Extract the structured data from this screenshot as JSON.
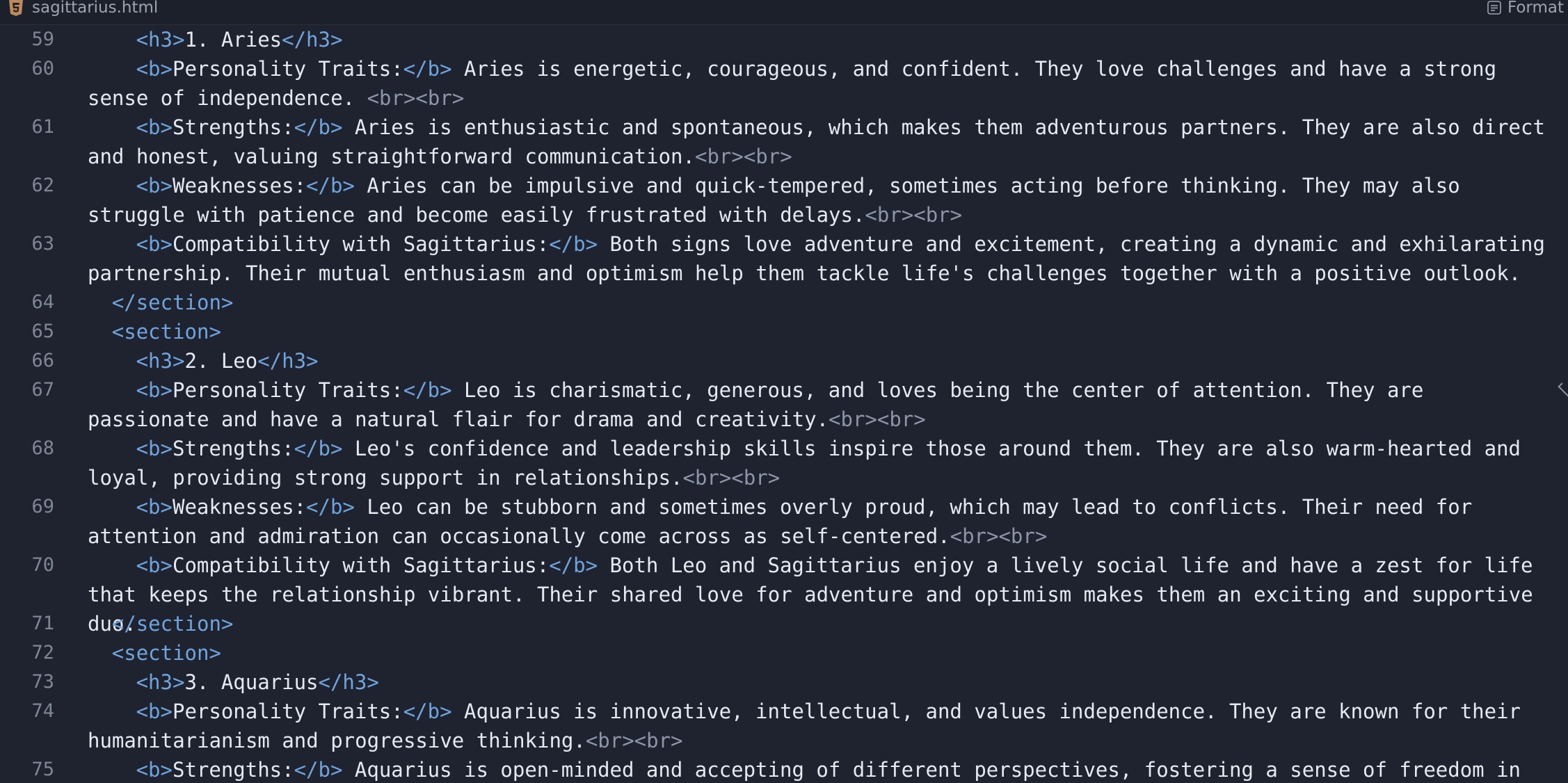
{
  "header": {
    "file_name": "sagittarius.html",
    "format_label": "Format"
  },
  "icons": {
    "file": "html5-file-icon",
    "format": "format-icon"
  },
  "colors": {
    "background": "#1f2330",
    "tag": "#6fa4dc",
    "text": "#e6e9ef",
    "line_number": "#7f8796"
  },
  "lines": [
    {
      "n": "59",
      "indent": 4,
      "parts": [
        [
          "tag",
          "<h3>"
        ],
        [
          "text",
          "1. Aries"
        ],
        [
          "tag",
          "</h3>"
        ]
      ]
    },
    {
      "n": "60",
      "indent": 4,
      "parts": [
        [
          "tag",
          "<b>"
        ],
        [
          "text",
          "Personality Traits:"
        ],
        [
          "tag",
          "</b>"
        ],
        [
          "text",
          " Aries is energetic, courageous, and confident. They love challenges and have a strong sense of independence. "
        ],
        [
          "br",
          "<br><br>"
        ]
      ]
    },
    {
      "n": "61",
      "indent": 4,
      "parts": [
        [
          "tag",
          "<b>"
        ],
        [
          "text",
          "Strengths:"
        ],
        [
          "tag",
          "</b>"
        ],
        [
          "text",
          " Aries is enthusiastic and spontaneous, which makes them adventurous partners. They are also direct and honest, valuing straightforward communication."
        ],
        [
          "br",
          "<br><br>"
        ]
      ]
    },
    {
      "n": "62",
      "indent": 4,
      "parts": [
        [
          "tag",
          "<b>"
        ],
        [
          "text",
          "Weaknesses:"
        ],
        [
          "tag",
          "</b>"
        ],
        [
          "text",
          " Aries can be impulsive and quick-tempered, sometimes acting before thinking. They may also struggle with patience and become easily frustrated with delays."
        ],
        [
          "br",
          "<br><br>"
        ]
      ]
    },
    {
      "n": "63",
      "indent": 4,
      "parts": [
        [
          "tag",
          "<b>"
        ],
        [
          "text",
          "Compatibility with Sagittarius:"
        ],
        [
          "tag",
          "</b>"
        ],
        [
          "text",
          " Both signs love adventure and excitement, creating a dynamic and exhilarating partnership. Their mutual enthusiasm and optimism help them tackle life's challenges together with a positive outlook."
        ]
      ]
    },
    {
      "n": "64",
      "indent": 2,
      "parts": [
        [
          "tag",
          "</section>"
        ]
      ]
    },
    {
      "n": "65",
      "indent": 2,
      "parts": [
        [
          "tag",
          "<section>"
        ]
      ]
    },
    {
      "n": "66",
      "indent": 4,
      "parts": [
        [
          "tag",
          "<h3>"
        ],
        [
          "text",
          "2. Leo"
        ],
        [
          "tag",
          "</h3>"
        ]
      ]
    },
    {
      "n": "67",
      "indent": 4,
      "parts": [
        [
          "tag",
          "<b>"
        ],
        [
          "text",
          "Personality Traits:"
        ],
        [
          "tag",
          "</b>"
        ],
        [
          "text",
          " Leo is charismatic, generous, and loves being the center of attention. They are passionate and have a natural flair for drama and creativity."
        ],
        [
          "br",
          "<br><br>"
        ]
      ]
    },
    {
      "n": "68",
      "indent": 4,
      "parts": [
        [
          "tag",
          "<b>"
        ],
        [
          "text",
          "Strengths:"
        ],
        [
          "tag",
          "</b>"
        ],
        [
          "text",
          " Leo's confidence and leadership skills inspire those around them. They are also warm-hearted and loyal, providing strong support in relationships."
        ],
        [
          "br",
          "<br><br>"
        ]
      ]
    },
    {
      "n": "69",
      "indent": 4,
      "parts": [
        [
          "tag",
          "<b>"
        ],
        [
          "text",
          "Weaknesses:"
        ],
        [
          "tag",
          "</b>"
        ],
        [
          "text",
          " Leo can be stubborn and sometimes overly proud, which may lead to conflicts. Their need for attention and admiration can occasionally come across as self-centered."
        ],
        [
          "br",
          "<br><br>"
        ]
      ]
    },
    {
      "n": "70",
      "indent": 4,
      "parts": [
        [
          "tag",
          "<b>"
        ],
        [
          "text",
          "Compatibility with Sagittarius:"
        ],
        [
          "tag",
          "</b>"
        ],
        [
          "text",
          " Both Leo and Sagittarius enjoy a lively social life and have a zest for life that keeps the relationship vibrant. Their shared love for adventure and optimism makes them an exciting and supportive duo."
        ]
      ]
    },
    {
      "n": "71",
      "indent": 2,
      "parts": [
        [
          "tag",
          "</section>"
        ]
      ]
    },
    {
      "n": "72",
      "indent": 2,
      "parts": [
        [
          "tag",
          "<section>"
        ]
      ]
    },
    {
      "n": "73",
      "indent": 4,
      "parts": [
        [
          "tag",
          "<h3>"
        ],
        [
          "text",
          "3. Aquarius"
        ],
        [
          "tag",
          "</h3>"
        ]
      ]
    },
    {
      "n": "74",
      "indent": 4,
      "parts": [
        [
          "tag",
          "<b>"
        ],
        [
          "text",
          "Personality Traits:"
        ],
        [
          "tag",
          "</b>"
        ],
        [
          "text",
          " Aquarius is innovative, intellectual, and values independence. They are known for their humanitarianism and progressive thinking."
        ],
        [
          "br",
          "<br><br>"
        ]
      ]
    },
    {
      "n": "75",
      "indent": 4,
      "parts": [
        [
          "tag",
          "<b>"
        ],
        [
          "text",
          "Strengths:"
        ],
        [
          "tag",
          "</b>"
        ],
        [
          "text",
          " Aquarius is open-minded and accepting of different perspectives, fostering a sense of freedom in"
        ]
      ]
    }
  ]
}
